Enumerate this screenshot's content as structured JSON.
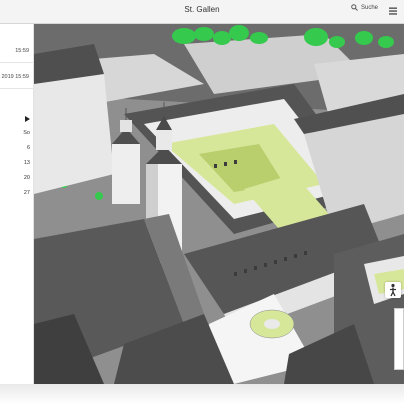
{
  "header": {
    "title": "St. Gallen",
    "search_label": "Suche"
  },
  "panel": {
    "time_1": "15:59",
    "time_2": "2019 15:59",
    "calendar": {
      "weekday_header": "So",
      "days": [
        "6",
        "13",
        "20",
        "27"
      ]
    }
  },
  "icons": {
    "search": "search-icon",
    "menu": "hamburger-menu-icon",
    "calendar_next": "chevron-right-icon",
    "pedestrian": "pedestrian-icon"
  },
  "colors": {
    "header_bg": "#f4f4f4",
    "lawn": "#d7e79a",
    "tree": "#35c94d",
    "roof": "#5a5a5a"
  }
}
